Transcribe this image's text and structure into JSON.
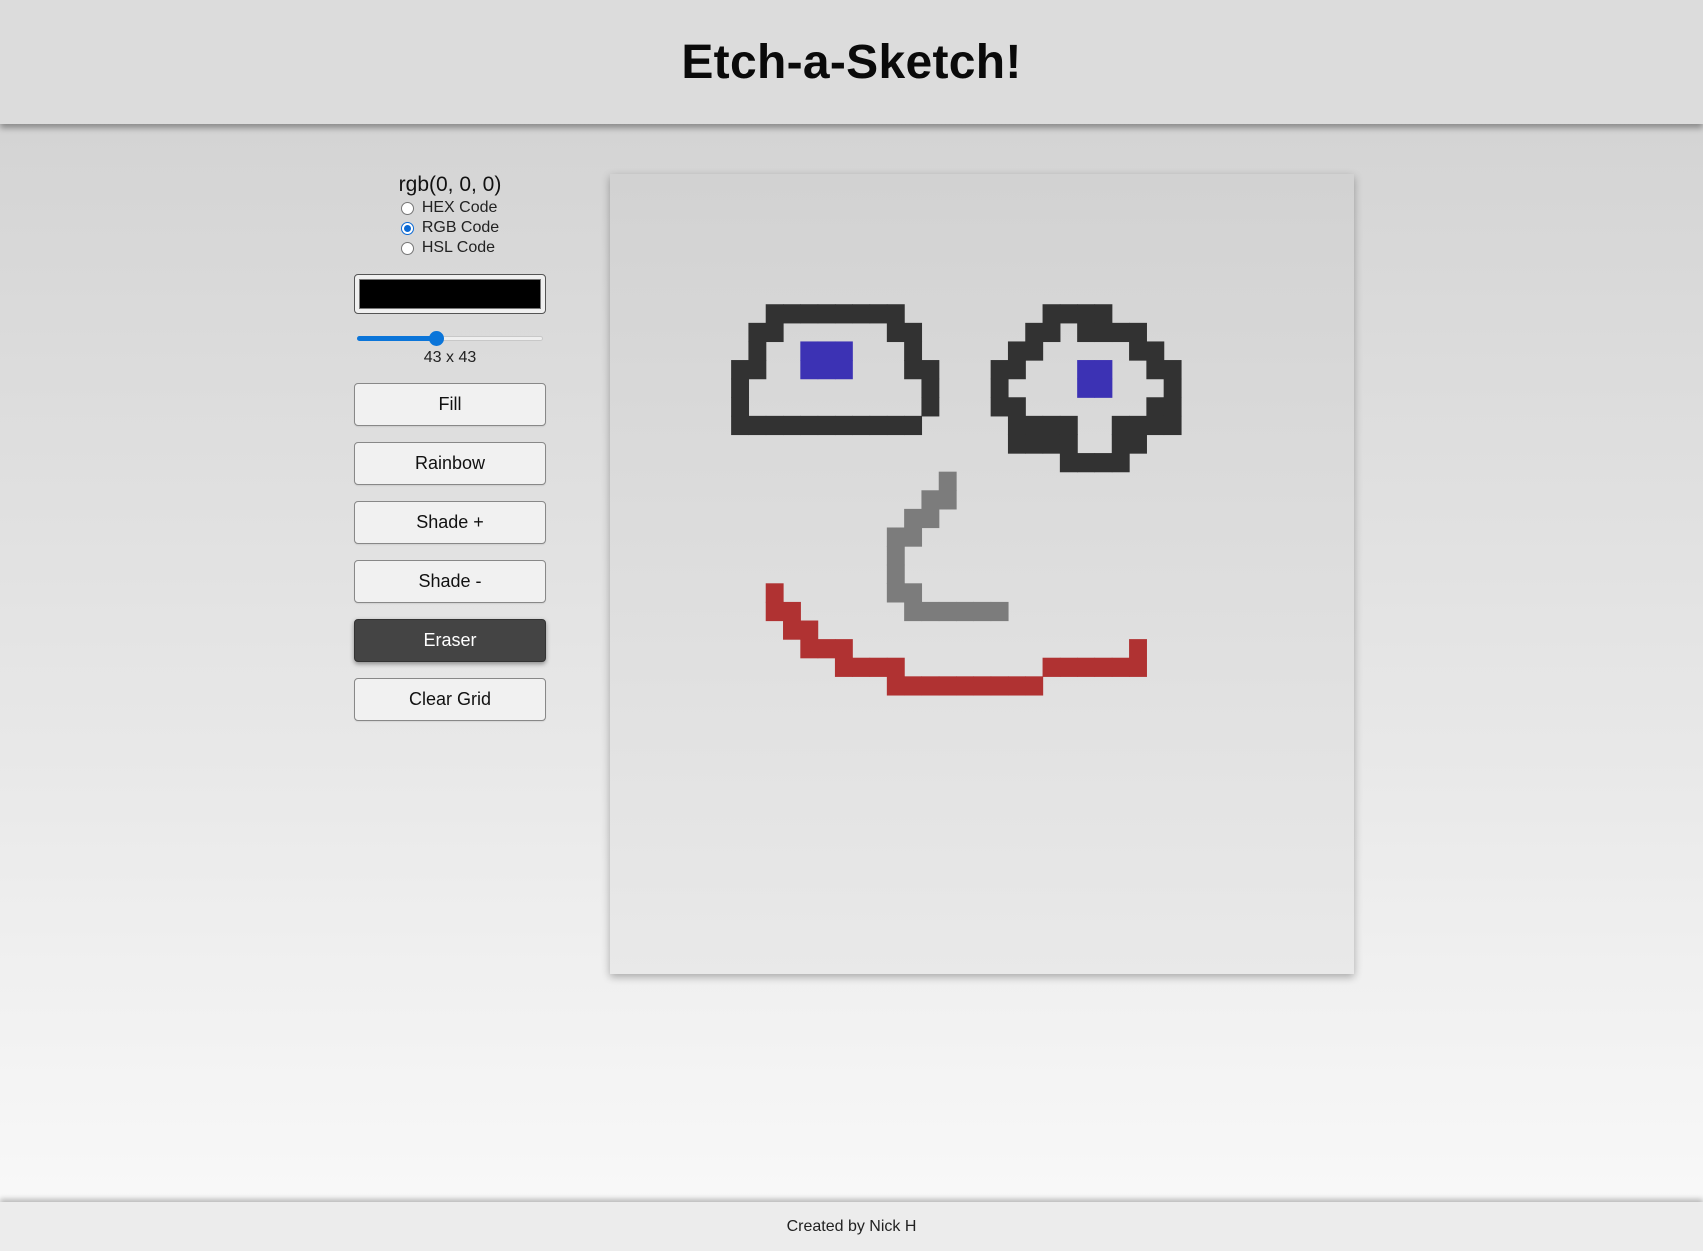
{
  "header": {
    "title": "Etch-a-Sketch!"
  },
  "controls": {
    "color_code": "rgb(0, 0, 0)",
    "color_formats": [
      {
        "label": "HEX Code",
        "checked": false
      },
      {
        "label": "RGB Code",
        "checked": true
      },
      {
        "label": "HSL Code",
        "checked": false
      }
    ],
    "selected_color": "#000000",
    "grid_size_value": 43,
    "grid_size_label": "43 x 43",
    "buttons": [
      {
        "label": "Fill",
        "active": false
      },
      {
        "label": "Rainbow",
        "active": false
      },
      {
        "label": "Shade +",
        "active": false
      },
      {
        "label": "Shade -",
        "active": false
      },
      {
        "label": "Eraser",
        "active": true
      },
      {
        "label": "Clear Grid",
        "active": false
      }
    ]
  },
  "drawing": {
    "grid_size": 43,
    "colors": {
      "outline": "#323232",
      "pupil": "#3c32b4",
      "nose": "#7c7c7c",
      "mouth": "#b03232"
    },
    "cells": {
      "outline": [
        [
          9,
          7
        ],
        [
          10,
          7
        ],
        [
          11,
          7
        ],
        [
          12,
          7
        ],
        [
          13,
          7
        ],
        [
          14,
          7
        ],
        [
          15,
          7
        ],
        [
          16,
          7
        ],
        [
          8,
          8
        ],
        [
          9,
          8
        ],
        [
          16,
          8
        ],
        [
          17,
          8
        ],
        [
          8,
          9
        ],
        [
          17,
          9
        ],
        [
          7,
          10
        ],
        [
          8,
          10
        ],
        [
          17,
          10
        ],
        [
          18,
          10
        ],
        [
          7,
          11
        ],
        [
          18,
          11
        ],
        [
          7,
          12
        ],
        [
          18,
          12
        ],
        [
          7,
          13
        ],
        [
          8,
          13
        ],
        [
          9,
          13
        ],
        [
          10,
          13
        ],
        [
          11,
          13
        ],
        [
          12,
          13
        ],
        [
          13,
          13
        ],
        [
          14,
          13
        ],
        [
          15,
          13
        ],
        [
          16,
          13
        ],
        [
          17,
          13
        ],
        [
          25,
          7
        ],
        [
          26,
          7
        ],
        [
          27,
          7
        ],
        [
          28,
          7
        ],
        [
          24,
          8
        ],
        [
          25,
          8
        ],
        [
          27,
          8
        ],
        [
          28,
          8
        ],
        [
          29,
          8
        ],
        [
          30,
          8
        ],
        [
          23,
          9
        ],
        [
          24,
          9
        ],
        [
          30,
          9
        ],
        [
          31,
          9
        ],
        [
          22,
          10
        ],
        [
          23,
          10
        ],
        [
          31,
          10
        ],
        [
          32,
          10
        ],
        [
          22,
          11
        ],
        [
          32,
          11
        ],
        [
          22,
          12
        ],
        [
          23,
          12
        ],
        [
          31,
          12
        ],
        [
          32,
          12
        ],
        [
          23,
          13
        ],
        [
          24,
          13
        ],
        [
          25,
          13
        ],
        [
          26,
          13
        ],
        [
          29,
          13
        ],
        [
          30,
          13
        ],
        [
          31,
          13
        ],
        [
          32,
          13
        ],
        [
          23,
          14
        ],
        [
          24,
          14
        ],
        [
          25,
          14
        ],
        [
          26,
          14
        ],
        [
          29,
          14
        ],
        [
          30,
          14
        ],
        [
          26,
          15
        ],
        [
          27,
          15
        ],
        [
          28,
          15
        ],
        [
          29,
          15
        ]
      ],
      "pupil": [
        [
          11,
          9
        ],
        [
          12,
          9
        ],
        [
          13,
          9
        ],
        [
          11,
          10
        ],
        [
          12,
          10
        ],
        [
          13,
          10
        ],
        [
          27,
          10
        ],
        [
          28,
          10
        ],
        [
          27,
          11
        ],
        [
          28,
          11
        ]
      ],
      "nose": [
        [
          19,
          16
        ],
        [
          19,
          17
        ],
        [
          18,
          17
        ],
        [
          18,
          18
        ],
        [
          17,
          18
        ],
        [
          17,
          19
        ],
        [
          16,
          19
        ],
        [
          16,
          20
        ],
        [
          16,
          21
        ],
        [
          16,
          22
        ],
        [
          17,
          22
        ],
        [
          17,
          23
        ],
        [
          18,
          23
        ],
        [
          19,
          23
        ],
        [
          20,
          23
        ],
        [
          21,
          23
        ],
        [
          22,
          23
        ]
      ],
      "mouth": [
        [
          9,
          22
        ],
        [
          9,
          23
        ],
        [
          10,
          23
        ],
        [
          10,
          24
        ],
        [
          11,
          24
        ],
        [
          11,
          25
        ],
        [
          12,
          25
        ],
        [
          13,
          25
        ],
        [
          13,
          26
        ],
        [
          14,
          26
        ],
        [
          15,
          26
        ],
        [
          16,
          26
        ],
        [
          16,
          27
        ],
        [
          17,
          27
        ],
        [
          18,
          27
        ],
        [
          19,
          27
        ],
        [
          20,
          27
        ],
        [
          21,
          27
        ],
        [
          22,
          27
        ],
        [
          23,
          27
        ],
        [
          24,
          27
        ],
        [
          25,
          26
        ],
        [
          26,
          26
        ],
        [
          27,
          26
        ],
        [
          28,
          26
        ],
        [
          29,
          26
        ],
        [
          30,
          26
        ],
        [
          30,
          25
        ]
      ]
    }
  },
  "footer": {
    "text": "Created by Nick H"
  }
}
